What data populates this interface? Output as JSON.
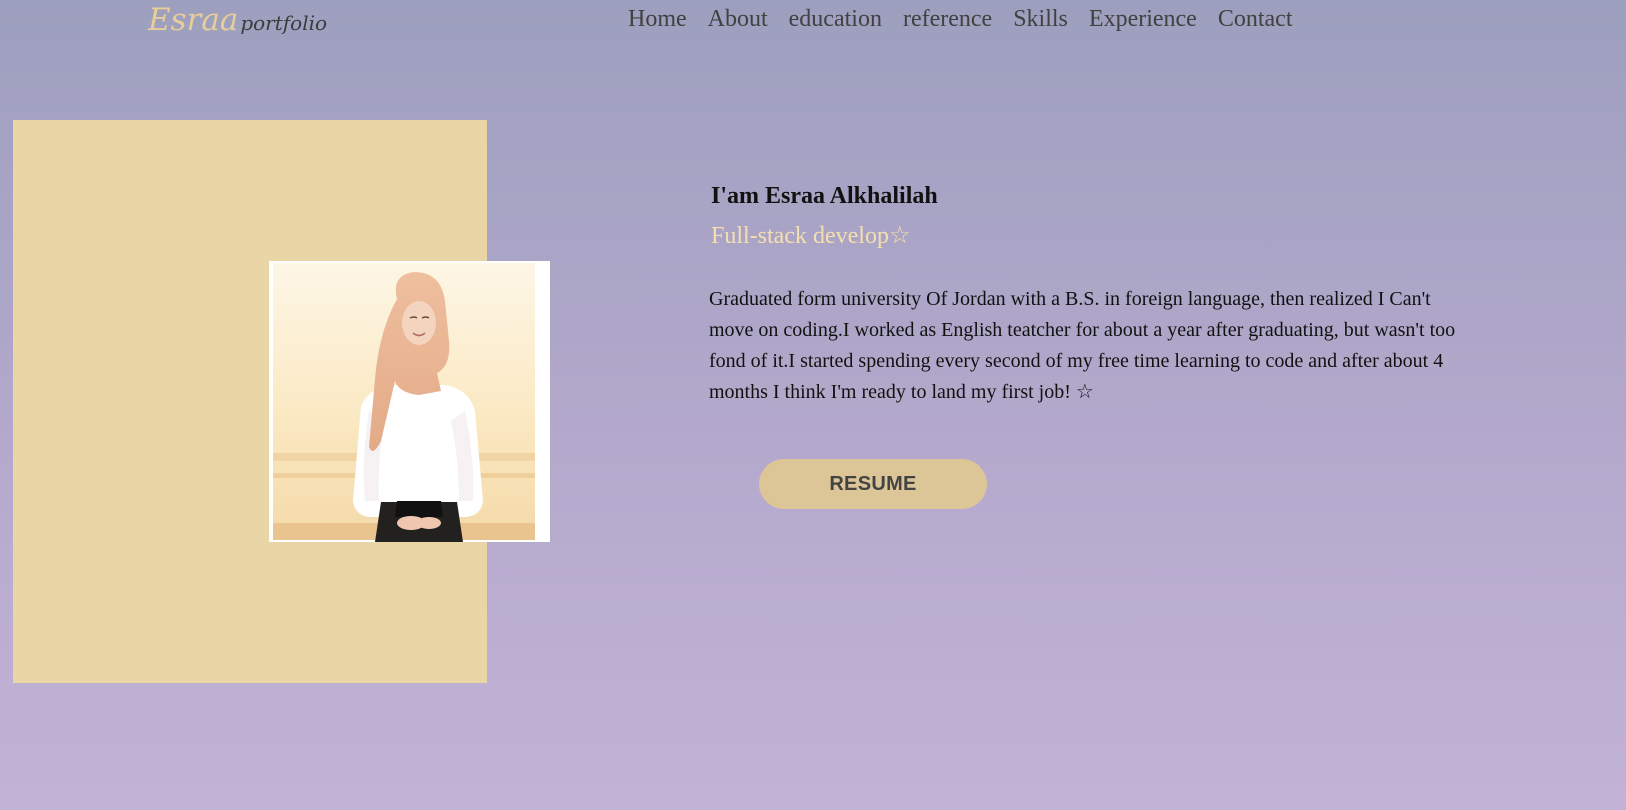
{
  "logo": {
    "main": "Esraa",
    "sub": "portfolio"
  },
  "nav": {
    "items": [
      {
        "label": "Home"
      },
      {
        "label": "About"
      },
      {
        "label": "education"
      },
      {
        "label": "reference"
      },
      {
        "label": "Skills"
      },
      {
        "label": "Experience"
      },
      {
        "label": "Contact"
      }
    ]
  },
  "profile": {
    "name": "I'am Esraa Alkhalilah",
    "role": "Full-stack develop☆",
    "bio": "Graduated form university Of Jordan with a B.S. in foreign language, then realized I Can't move on coding.I worked as English teatcher for about a year after graduating, but wasn't too fond of it.I started spending every second of my free time learning to code and after about 4 months I think I'm ready to land my first job! ☆",
    "resume_label": "RESUME"
  },
  "colors": {
    "accent": "#e7cd97",
    "photo_backdrop": "#ead5a6",
    "button": "#dcc697"
  }
}
